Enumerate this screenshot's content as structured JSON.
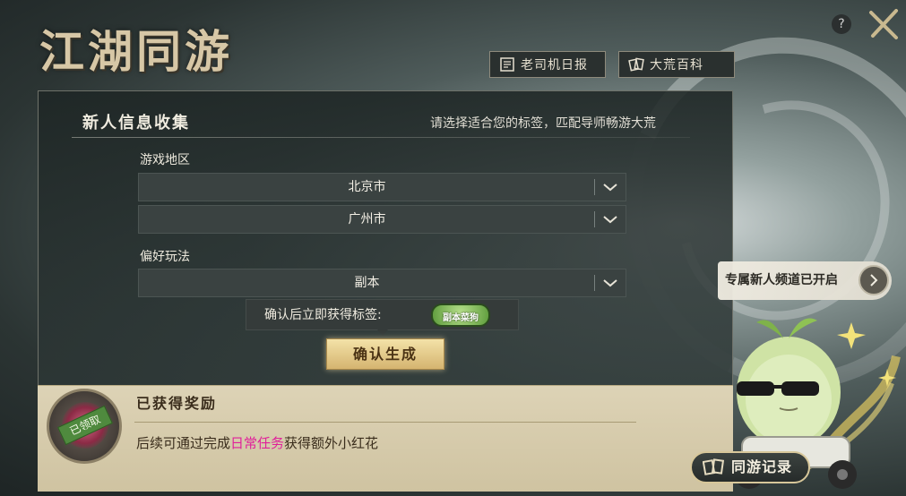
{
  "header": {
    "title": "江湖同游",
    "help": "?",
    "buttons": [
      {
        "label": "老司机日报",
        "icon": "newspaper-icon"
      },
      {
        "label": "大荒百科",
        "icon": "cards-icon"
      }
    ]
  },
  "form": {
    "title": "新人信息收集",
    "hint": "请选择适合您的标签，匹配导师畅游大荒",
    "region_label": "游戏地区",
    "region_values": [
      "北京市",
      "广州市"
    ],
    "preference_label": "偏好玩法",
    "preference_value": "副本",
    "tag_prompt": "确认后立即获得标签:",
    "tag_badge": "副本菜狗",
    "confirm_label": "确认生成"
  },
  "reward": {
    "title": "已获得奖励",
    "claimed_stamp": "已领取",
    "text_before": "后续可通过完成",
    "text_highlight": "日常任务",
    "text_after": "获得额外小红花",
    "highlight_color": "#e0209a"
  },
  "side": {
    "channel_label": "专属新人频道已开启",
    "record_label": "同游记录"
  }
}
